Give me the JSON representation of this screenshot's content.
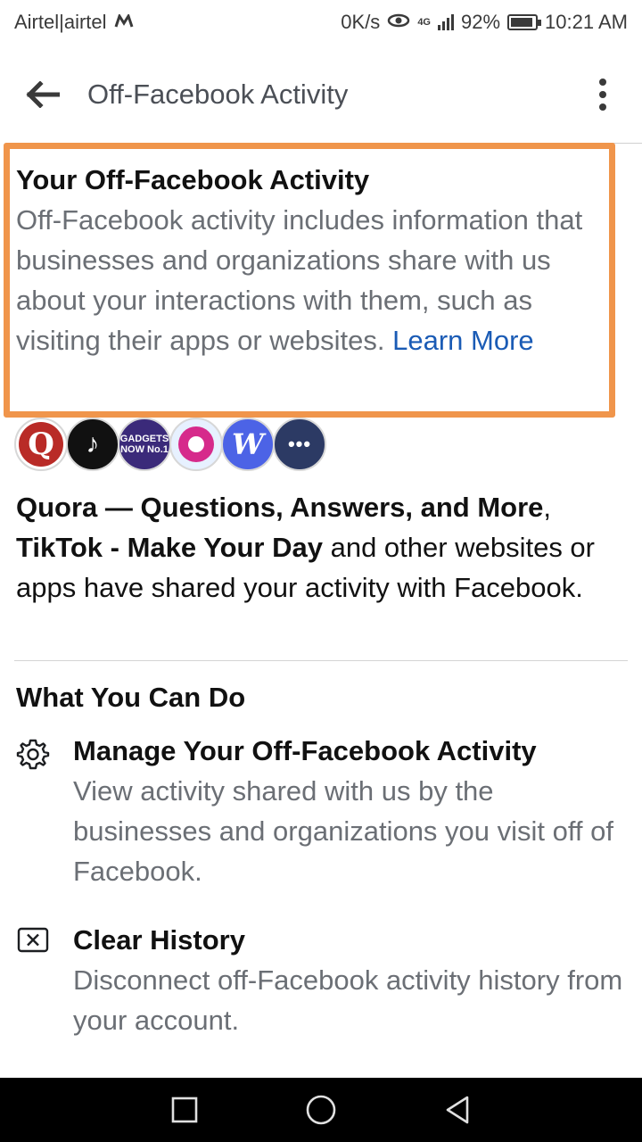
{
  "status_bar": {
    "carrier": "Airtel|airtel",
    "carrier_icon": "m-logo-icon",
    "data_speed": "0K/s",
    "network": "4G",
    "battery": "92%",
    "battery_level": 0.92,
    "time": "10:21 AM"
  },
  "app_bar": {
    "title": "Off-Facebook Activity",
    "back_icon": "arrow-left-icon",
    "menu_icon": "more-vertical-icon"
  },
  "intro": {
    "heading": "Your Off-Facebook Activity",
    "body": "Off-Facebook activity includes information that businesses and organizations share with us about your interactions with them, such as visiting their apps or websites. ",
    "link": "Learn More"
  },
  "avatars": [
    {
      "label": "Q",
      "icon": "quora-icon"
    },
    {
      "label": "♪",
      "icon": "tiktok-icon"
    },
    {
      "label": "GADGETS NOW No.1",
      "icon": "gadgets-now-icon"
    },
    {
      "label": "",
      "icon": "app-icon"
    },
    {
      "label": "W",
      "icon": "w-app-icon"
    },
    {
      "label": "•••",
      "icon": "more-apps-icon"
    }
  ],
  "shared": {
    "app1": "Quora — Questions, Answers, and More",
    "separator": ",",
    "app2": "TikTok - Make Your Day",
    "rest": " and other websites or apps have shared your activity with Facebook."
  },
  "what_you_can_do": {
    "heading": "What You Can Do",
    "actions": [
      {
        "icon": "gear-icon",
        "title": "Manage Your Off-Facebook Activity",
        "description": "View activity shared with us by the businesses and organizations you visit off of Facebook."
      },
      {
        "icon": "clear-x-icon",
        "title": "Clear History",
        "description": "Disconnect off-Facebook activity history from your account."
      }
    ]
  },
  "colors": {
    "highlight_border": "#f0954b",
    "link": "#1a5bb5",
    "muted_text": "#6b6f75"
  },
  "nav_bar": {
    "buttons": [
      "recents-square-icon",
      "home-circle-icon",
      "back-triangle-icon"
    ]
  }
}
